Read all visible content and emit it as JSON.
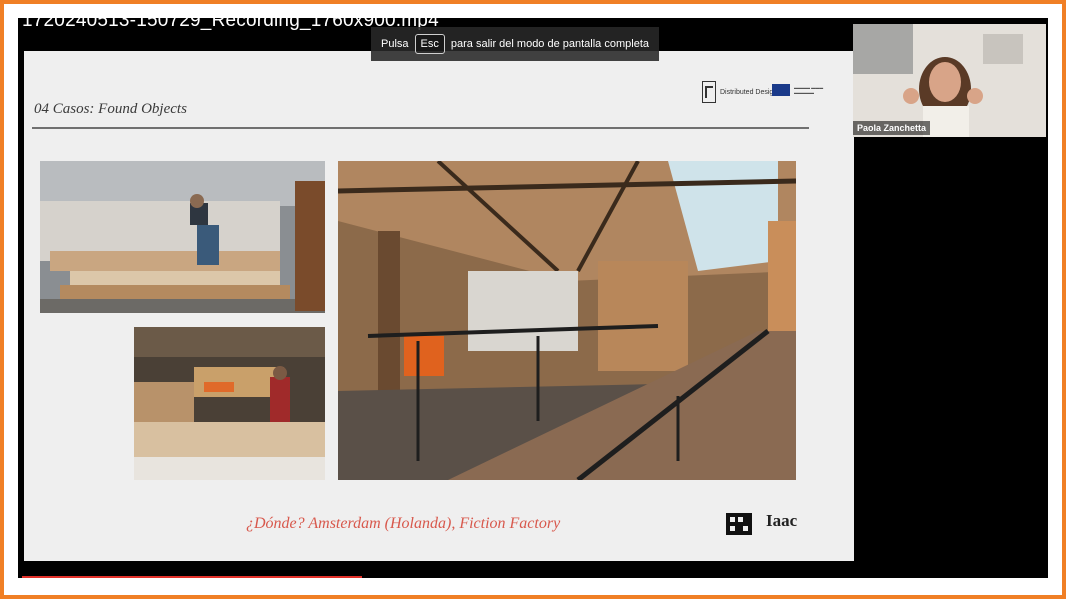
{
  "video": {
    "title": "1720240513-150729_Recording_1760x900.mp4"
  },
  "fullscreen_notice": {
    "prefix": "Pulsa",
    "key": "Esc",
    "suffix": "para salir del modo de pantalla completa"
  },
  "slide": {
    "title": "04 Casos: Found Objects",
    "caption": "¿Dónde? Amsterdam (Holanda), Fiction Factory",
    "logo_distributed": "Distributed Design",
    "logo_iaac": "Iaac"
  },
  "participant": {
    "name": "Paola Zanchetta"
  },
  "colors": {
    "frame_border": "#f07f25",
    "caption": "#d8584c",
    "progress": "#e2312a"
  }
}
